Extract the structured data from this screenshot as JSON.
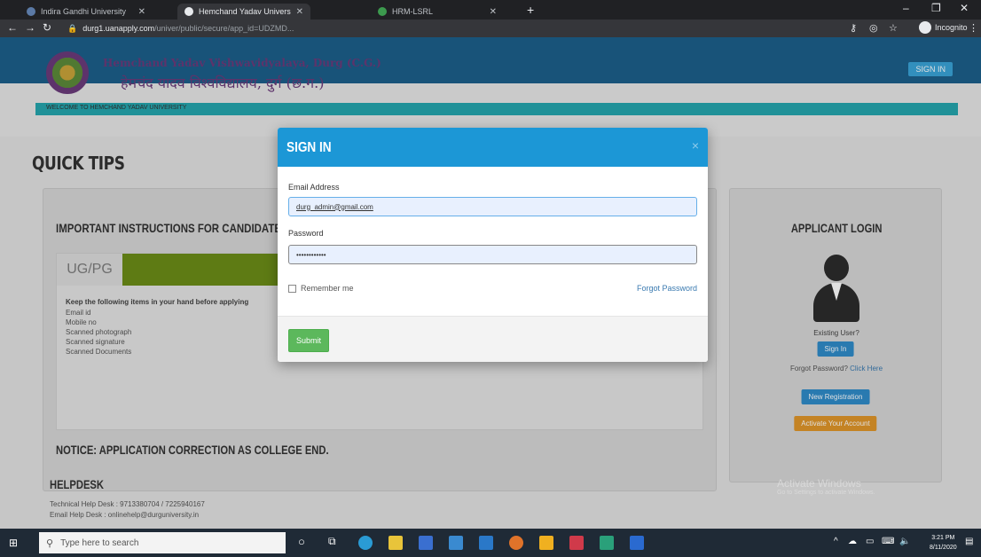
{
  "browser": {
    "tabs": [
      {
        "label": "Indira Gandhi University",
        "active": false
      },
      {
        "label": "Hemchand Yadav University",
        "active": true
      },
      {
        "label": "HRM-LSRL",
        "active": false
      }
    ],
    "url_host": "durg1.uanapply.com",
    "url_path": "/univer/public/secure/app_id=UDZMD...",
    "incognito_label": "Incognito"
  },
  "site": {
    "top_signin": "SIGN IN",
    "university_en": "Hemchand Yadav Vishwavidyalaya, Durg (C.G.)",
    "university_hi": "हेमचंद यादव विश्वविद्यालय, दुर्ग (छ.ग.)",
    "marquee": "WELCOME TO HEMCHAND YADAV UNIVERSITY",
    "quick_tips": "QUICK TIPS",
    "panel_heading": "IMPORTANT INSTRUCTIONS FOR CANDIDATES",
    "ug_tab": "UG/PG",
    "keep_items": "Keep the following items in your hand before applying",
    "requirements": [
      "Email id",
      "Mobile no",
      "Scanned photograph",
      "Scanned signature",
      "Scanned Documents"
    ],
    "notice": "NOTICE: APPLICATION CORRECTION AS COLLEGE END.",
    "helpdesk": "HELPDESK",
    "helpdesk_lines": [
      "Technical Help Desk : 9713380704 / 7225940167",
      "Email Help Desk : onlinehelp@durguniversity.in"
    ]
  },
  "applicant": {
    "heading": "APPLICANT LOGIN",
    "existing": "Existing User?",
    "sign_in": "Sign In",
    "forgot_prefix": "Forgot Password?",
    "forgot_link": "Click Here",
    "new_registration": "New Registration",
    "activate_account": "Activate Your Account"
  },
  "watermark": {
    "title": "Activate Windows",
    "subtitle": "Go to Settings to activate Windows."
  },
  "modal": {
    "title": "SIGN IN",
    "email_label": "Email Address",
    "email_value": "durg_admin@gmail.com",
    "password_label": "Password",
    "password_value": "••••••••••••",
    "remember": "Remember me",
    "forgot": "Forgot Password",
    "submit": "Submit"
  },
  "taskbar": {
    "search_placeholder": "Type here to search",
    "time": "3:21 PM",
    "date": "8/11/2020"
  }
}
